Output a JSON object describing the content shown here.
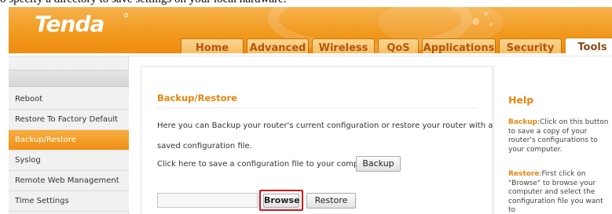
{
  "caption": "o specify a directory to save settings on your local hardware.",
  "brand": {
    "logo": "Tenda"
  },
  "tabs": [
    {
      "label": "Home",
      "active": false
    },
    {
      "label": "Advanced",
      "active": false
    },
    {
      "label": "Wireless",
      "active": false
    },
    {
      "label": "QoS",
      "active": false
    },
    {
      "label": "Applications",
      "active": false
    },
    {
      "label": "Security",
      "active": false
    },
    {
      "label": "Tools",
      "active": true
    }
  ],
  "sidebar": {
    "items": [
      {
        "label": "Reboot",
        "active": false
      },
      {
        "label": "Restore To Factory Default",
        "active": false
      },
      {
        "label": "Backup/Restore",
        "active": true
      },
      {
        "label": "Syslog",
        "active": false
      },
      {
        "label": "Remote Web Management",
        "active": false
      },
      {
        "label": "Time Settings",
        "active": false
      }
    ]
  },
  "main": {
    "title": "Backup/Restore",
    "desc1": "Here you can Backup your router's current configuration or restore your router with a",
    "desc2": "saved configuration file.",
    "desc3": "Click here to save a configuration file to your computer:",
    "backup_label": "Backup",
    "file_value": "",
    "browse_label": "Browse",
    "restore_label": "Restore"
  },
  "help": {
    "title": "Help",
    "backup_kw": "Backup",
    "backup_text": ":Click on this button to save a copy of your router's configurations to your computer.",
    "restore_kw": "Restore",
    "restore_text": ":First click on \"Browse\" to browse your computer and select the configuration file you want to"
  },
  "colors": {
    "brand_orange": "#f19a1f",
    "section_title": "#e8850f",
    "highlight_red": "#d3141b"
  }
}
